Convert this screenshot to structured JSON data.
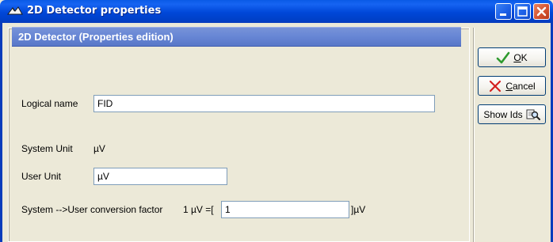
{
  "window": {
    "title": "2D Detector properties",
    "app_icon": "app-icon",
    "controls": [
      "minimize-icon",
      "maximize-icon",
      "close-icon"
    ]
  },
  "panel": {
    "header": "2D Detector (Properties edition)"
  },
  "form": {
    "logical_name_label": "Logical name",
    "logical_name_value": "FID",
    "system_unit_label": "System Unit",
    "system_unit_value": "µV",
    "user_unit_label": "User Unit",
    "user_unit_value": "µV",
    "conversion_label": "System -->User conversion factor",
    "conversion_prefix": "1 µV =[",
    "conversion_value": "1",
    "conversion_suffix": "]µV"
  },
  "buttons": {
    "ok_accel": "O",
    "ok_rest": "K",
    "cancel_accel": "C",
    "cancel_rest": "ancel",
    "show_ids": "Show Ids"
  },
  "colors": {
    "title_bar": "#0047d8",
    "header_band": "#6887d5",
    "dialog_bg": "#ece9d8",
    "ok_check": "#2e9a2e",
    "cancel_x": "#d42020"
  }
}
